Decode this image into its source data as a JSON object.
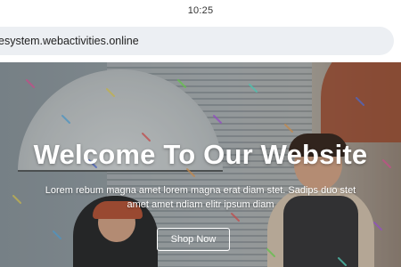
{
  "status_bar": {
    "time": "10:25"
  },
  "browser": {
    "url": "esystem.webactivities.online"
  },
  "hero": {
    "title": "Welcome To Our Website",
    "subtitle": "Lorem rebum magna amet lorem magna erat diam stet. Sadips duo stet amet amet ndiam elitr ipsum diam",
    "cta_label": "Shop Now",
    "image_icon": "children-with-umbrellas-photo"
  }
}
